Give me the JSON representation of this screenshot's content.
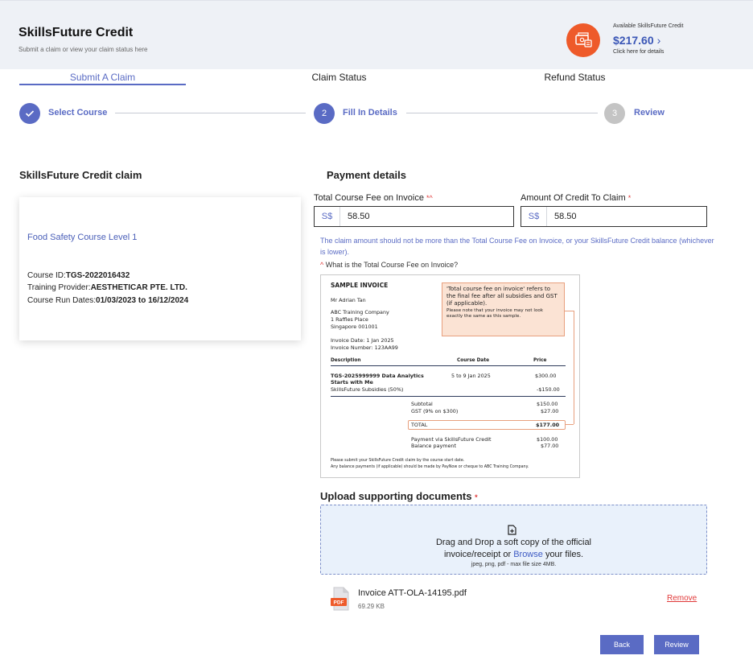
{
  "header": {
    "title": "SkillsFuture Credit",
    "subtitle": "Submit a claim or view your claim status here",
    "credit_label": "Available SkillsFuture Credit",
    "credit_amount": "$217.60",
    "credit_chevron": "›",
    "credit_hint": "Click here for details",
    "credit_icon": "money-card-icon",
    "accent_color": "#ee5a2a"
  },
  "tabs": [
    {
      "label": "Submit A Claim",
      "active": true
    },
    {
      "label": "Claim Status",
      "active": false
    },
    {
      "label": "Refund Status",
      "active": false
    }
  ],
  "stepper": {
    "steps": [
      {
        "number": "",
        "label": "Select Course",
        "state": "completed",
        "icon": "check-icon"
      },
      {
        "number": "2",
        "label": "Fill In Details",
        "state": "current"
      },
      {
        "number": "3",
        "label": "Review",
        "state": "pending"
      }
    ],
    "active_color": "#5a6bc4",
    "pending_color": "#c4c4c4"
  },
  "claim": {
    "section_title": "SkillsFuture Credit claim",
    "course_name": "Food Safety Course Level 1",
    "course_id_label": "Course ID:",
    "course_id": "TGS-2022016432",
    "provider_label": "Training Provider:",
    "provider": "AESTHETICAR PTE. LTD.",
    "dates_label": "Course Run Dates:",
    "dates": "01/03/2023 to 16/12/2024"
  },
  "payment": {
    "section_title": "Payment details",
    "total_fee": {
      "label": "Total Course Fee on Invoice",
      "required_mark": "*^",
      "prefix": "S$",
      "value": "58.50"
    },
    "credit_claim": {
      "label": "Amount Of Credit To Claim",
      "required_mark": "*",
      "prefix": "S$",
      "value": "58.50"
    },
    "hint": "The claim amount should not be more than the Total Course Fee on Invoice, or your SkillsFuture Credit balance (whichever is lower).",
    "fee_question_mark": "^",
    "fee_question": "What is the Total Course Fee on Invoice?"
  },
  "invoice": {
    "title": "SAMPLE INVOICE",
    "recipient": "Mr Adrian Tan",
    "company": "ABC Training Company",
    "address1": "1 Raffles Place",
    "address2": "Singapore 001001",
    "invoice_date": "Invoice Date: 1 Jan 2025",
    "invoice_number": "Invoice Number: 123AA99",
    "callout_main": "'Total course fee on invoice' refers to the final fee after all subsidies and GST (if applicable).",
    "callout_sub": "Please note that your invoice may not look exactly the same as this sample.",
    "col_description": "Description",
    "col_course_date": "Course Date",
    "col_price": "Price",
    "item_name_1": "TGS-2025999999 Data Analytics",
    "item_name_2": "Starts with Me",
    "item_date": "5 to 9 Jan 2025",
    "item_price": "$300.00",
    "subsidy_label": "SkillsFuture Subsidies (50%)",
    "subsidy_value": "-$150.00",
    "subtotal_label": "Subtotal",
    "subtotal_value": "$150.00",
    "gst_label": "GST (9% on $300)",
    "gst_value": "$27.00",
    "total_label": "TOTAL",
    "total_value": "$177.00",
    "sfc_payment_label": "Payment via SkillsFuture Credit",
    "sfc_payment_value": "$100.00",
    "balance_label": "Balance payment",
    "balance_value": "$77.00",
    "footer_1": "Please submit your SkillsFuture Credit claim by the course start date.",
    "footer_2": "Any balance payments (if applicable) should be made by PayNow or cheque to ABC Training Company."
  },
  "upload": {
    "title": "Upload supporting documents",
    "required_mark": "*",
    "drop_text_1": "Drag and Drop a soft copy of the official",
    "drop_text_2a": "invoice/receipt or",
    "drop_browse": "Browse",
    "drop_text_2b": "your files.",
    "drop_note": "jpeg, png, pdf - max file size 4MB.",
    "file_name": "Invoice ATT-OLA-14195.pdf",
    "file_size": "69.29 KB",
    "file_badge": "PDF",
    "remove_label": "Remove"
  },
  "actions": {
    "back_label": "Back",
    "review_label": "Review"
  }
}
